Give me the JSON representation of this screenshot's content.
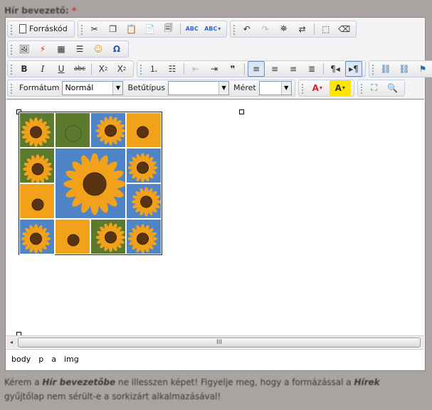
{
  "field": {
    "label": "Hír bevezető:",
    "required_mark": "*"
  },
  "toolbar": {
    "source_label": "Forráskód",
    "format_label": "Formátum",
    "format_value": "Normál",
    "font_label": "Betűtípus",
    "font_value": "",
    "size_label": "Méret",
    "size_value": ""
  },
  "scrollbar": {
    "grip": "III"
  },
  "path": [
    "body",
    "p",
    "a",
    "img"
  ],
  "note": {
    "p1": "Kérem a ",
    "b1": "Hír bevezetőbe",
    "p2": " ne illesszen képet! Figyelje meg, hogy a formázással a ",
    "b2": "Hírek",
    "p3": " gyűjtőlap nem sérült-e a sorkizárt alkalmazásával!"
  },
  "image": {
    "tiles": [
      "sunflower",
      "sunflower-bud",
      "sunflower",
      "sunflower",
      "sunflower",
      "sunflower-large",
      "sunflower",
      "sunflower",
      "sunflower",
      "sunflower",
      "sunflower",
      "sunflower",
      "sunflower",
      "sunflower"
    ]
  },
  "colors": {
    "petal": "#f2a21a",
    "center": "#5a3412",
    "sky": "#4f84c6",
    "leaf": "#5c7a2e"
  }
}
